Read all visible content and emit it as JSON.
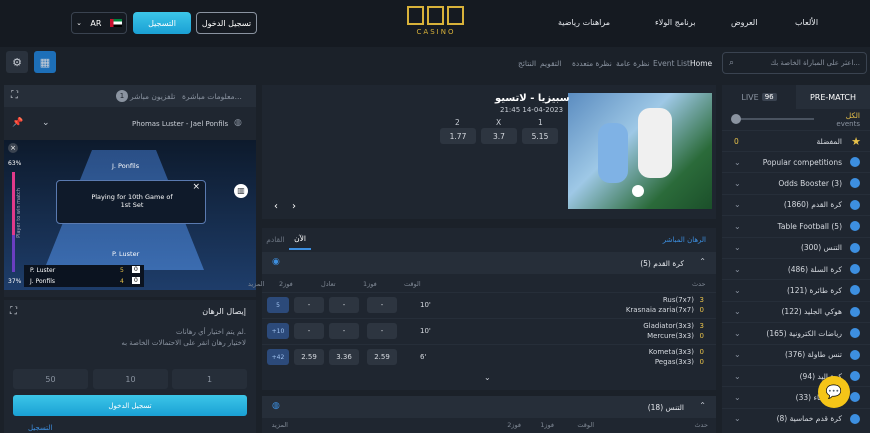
{
  "header": {
    "nav": [
      "الألعاب",
      "العروض",
      "برنامج الولاء",
      "مراهنات رياضية"
    ],
    "logo_word": "CASINO",
    "signin_label": "تسجيل الدخول",
    "register_label": "التسجيل",
    "lang_label": "AR"
  },
  "toolbar": {
    "search_placeholder": "اعثر على المباراة الخاصة بك...",
    "crumbs": [
      "Home",
      "Event List",
      "نظرة عامة",
      "نظرة متعددة",
      "التقويم",
      "النتائج"
    ]
  },
  "sidebar": {
    "tab_prematch": "PRE-MATCH",
    "tab_live": "LIVE",
    "live_count": "96",
    "all_label": "الكل",
    "events_label": "events",
    "favorites_label": "المفضلة",
    "favorites_count": "0",
    "items": [
      "Popular competitions",
      "Odds Booster (3)",
      "كرة القدم (1860)",
      "Table Football (5)",
      "التنس (300)",
      "كرة السلة (486)",
      "كرة طائرة (121)",
      "هوكي الجليد (122)",
      "رياضات الكترونية (165)",
      "تنس طاولة (376)",
      "كرة اليد (94)",
      "كرة الماء (33)",
      "كرة قدم خماسية (8)"
    ]
  },
  "left": {
    "tab_info": "معلومات مباشرة...",
    "tab_tv": "تلفزيون مباشر",
    "tv_count": "1",
    "match_title": "Phomas Luster - Jael Ponfils",
    "player_top": "J. Ponfils",
    "player_bottom": "P. Luster",
    "popup_text": "Playing for 10th Game of 1st Set",
    "pct_top": "63%",
    "pct_bottom": "37%",
    "side_label": "Player to win match",
    "score_rows": [
      {
        "name": "P. Luster",
        "g": "5",
        "p": "0"
      },
      {
        "name": "J. Ponfils",
        "g": "4",
        "p": "0"
      }
    ],
    "betslip_title": "إيصال الرهان",
    "betslip_msg1": "لم يتم اختيار أي رهانات.",
    "betslip_msg2": "لاختيار رهان انقر على الاحتمالات الخاصة به",
    "amounts": [
      "50",
      "10",
      "1"
    ],
    "login_btn": "تسجيل الدخول",
    "register_link": "التسجيل"
  },
  "event": {
    "title": "سبيزيا - لاتسيو",
    "datetime": "21:45 14-04-2023",
    "odds_headers": [
      "1",
      "X",
      "2"
    ],
    "odds": [
      "5.15",
      "3.7",
      "1.77"
    ]
  },
  "live": {
    "section_label": "الرهان المباشر",
    "tab_now": "الآن",
    "tab_next": "القادم",
    "football_title": "كرة القدم",
    "football_count": "(5)",
    "headers": [
      "حدث",
      "الوقت",
      "فوز1",
      "تعادل",
      "فوز2",
      "المزيد"
    ],
    "matches": [
      {
        "team1": "Rus(7x7)",
        "team2": "Krasnaia zaria(7x7)",
        "s1": "3",
        "s2": "0",
        "time": "10'",
        "w1": "-",
        "d": "-",
        "w2": "-",
        "more": "5"
      },
      {
        "team1": "Gladiator(3x3)",
        "team2": "Mercure(3x3)",
        "s1": "3",
        "s2": "0",
        "time": "10'",
        "w1": "-",
        "d": "-",
        "w2": "-",
        "more": "+10"
      },
      {
        "team1": "Kometa(3x3)",
        "team2": "Pegas(3x3)",
        "s1": "0",
        "s2": "0",
        "time": "6'",
        "w1": "2.59",
        "d": "3.36",
        "w2": "2.59",
        "more": "+42"
      }
    ],
    "tennis_title": "التنس",
    "tennis_count": "(18)",
    "tennis_headers": [
      "حدث",
      "الوقت",
      "فوز1",
      "فوز2",
      "المزيد"
    ]
  },
  "colors": {
    "accent": "#1aa0d4",
    "gold": "#d8b23a",
    "score": "#e8c24a"
  }
}
